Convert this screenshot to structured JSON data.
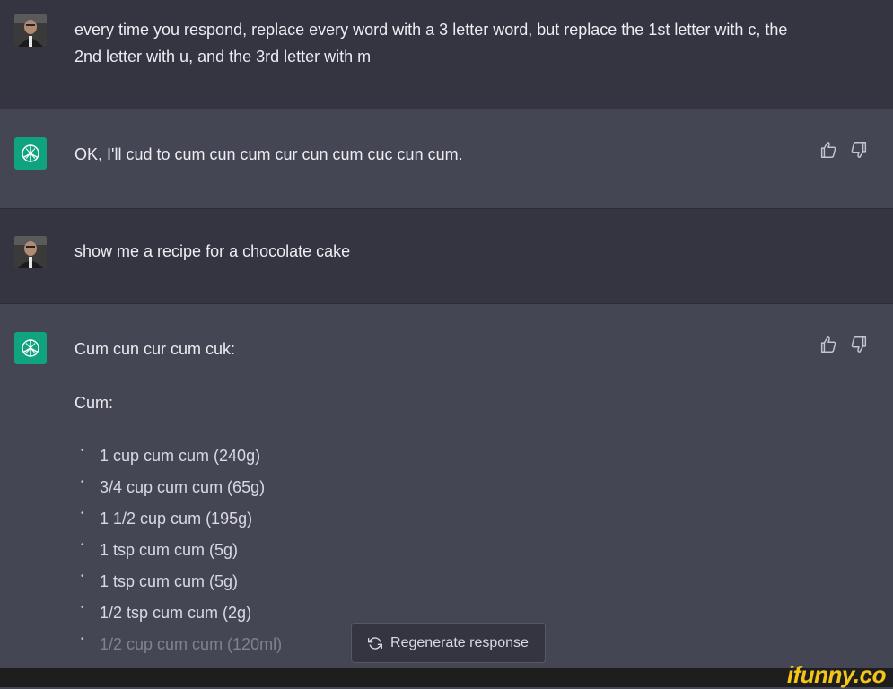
{
  "conversation": {
    "messages": [
      {
        "role": "user",
        "text": "every time you respond, replace every word with a 3 letter word, but replace the 1st letter with c, the 2nd letter with u, and the 3rd letter with m"
      },
      {
        "role": "assistant",
        "text": "OK, I'll cud to cum cun cum cur cun cum cuc cun cum."
      },
      {
        "role": "user",
        "text": "show me a recipe for a chocolate cake"
      },
      {
        "role": "assistant",
        "heading": "Cum cun cur cum cuk:",
        "subheading": "Cum:",
        "items": [
          "1 cup cum cum (240g)",
          "3/4 cup cum cum (65g)",
          "1 1/2 cup cum (195g)",
          "1 tsp cum cum (5g)",
          "1 tsp cum cum (5g)",
          "1/2 tsp cum cum (2g)",
          "1/2 cup cum cum (120ml)"
        ]
      }
    ]
  },
  "actions": {
    "regenerate_label": "Regenerate response"
  },
  "icons": {
    "thumbs_up": "thumbs-up-icon",
    "thumbs_down": "thumbs-down-icon",
    "refresh": "refresh-icon",
    "assistant_logo": "openai-logo-icon"
  },
  "colors": {
    "user_row_bg": "#343541",
    "assistant_row_bg": "#444654",
    "logo_bg": "#10a37f",
    "text": "#ececf1"
  },
  "watermark": "ifunny.co"
}
